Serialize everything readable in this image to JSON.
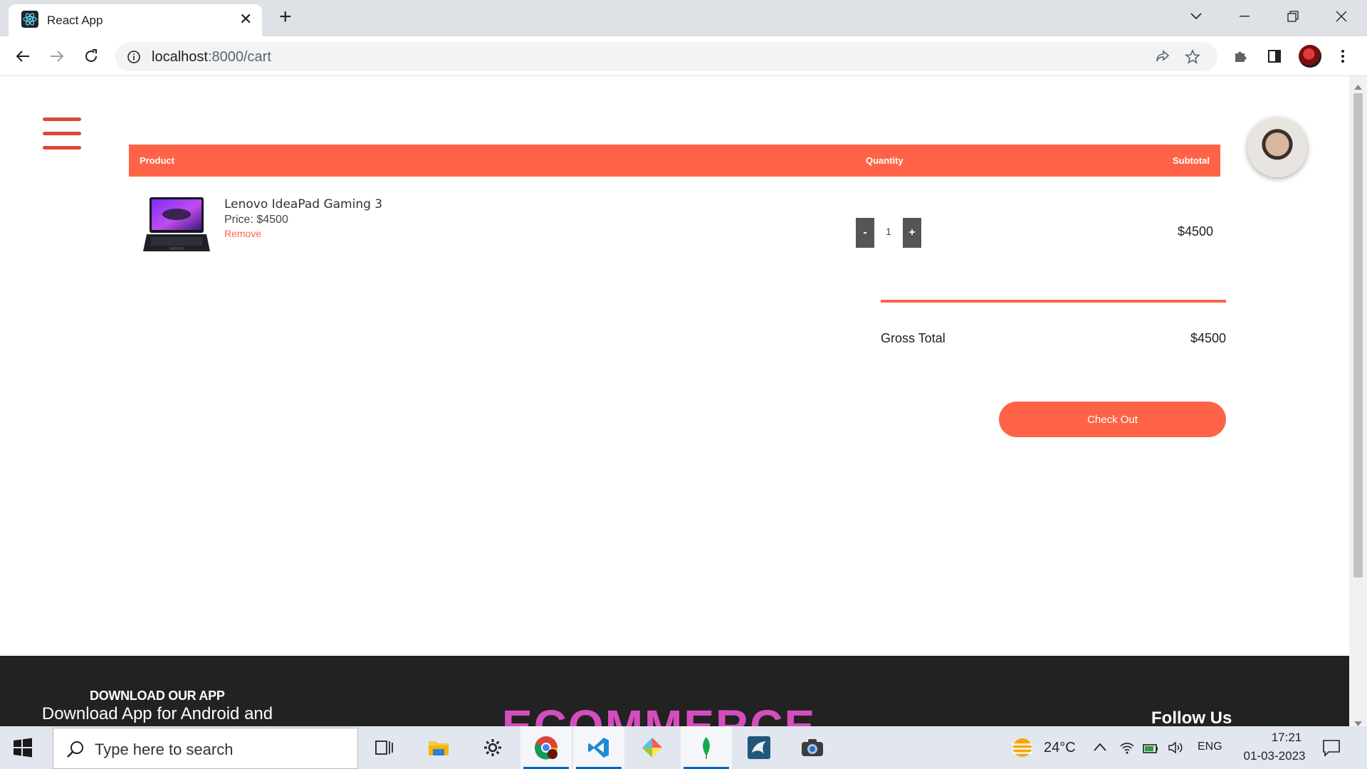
{
  "browser": {
    "tab_title": "React App",
    "url_host": "localhost",
    "url_path": ":8000/cart"
  },
  "cart": {
    "headers": {
      "product": "Product",
      "quantity": "Quantity",
      "subtotal": "Subtotal"
    },
    "items": [
      {
        "name": "Lenovo IdeaPad Gaming 3",
        "price": "Price: $4500",
        "remove": "Remove",
        "quantity": "1",
        "subtotal": "$4500"
      }
    ],
    "decrement_label": "-",
    "increment_label": "+",
    "gross_total_label": "Gross Total",
    "gross_total_value": "$4500",
    "checkout_label": "Check Out"
  },
  "footer": {
    "heading": "DOWNLOAD OUR APP",
    "text": "Download App for Android and IOS mobile phone",
    "logo": "ECOMMERCE",
    "follow": "Follow Us"
  },
  "taskbar": {
    "search_placeholder": "Type here to search",
    "apps": [
      "task-view",
      "file-explorer",
      "settings",
      "chrome",
      "vscode",
      "git",
      "mongodb",
      "mysql-workbench",
      "camera"
    ],
    "weather": "24°C",
    "language": "ENG",
    "time": "17:21",
    "date": "01-03-2023"
  },
  "colors": {
    "accent": "#ff6347",
    "hamburger": "#e0463a",
    "footer_bg": "#222222",
    "footer_logo": "#d44dbd"
  }
}
